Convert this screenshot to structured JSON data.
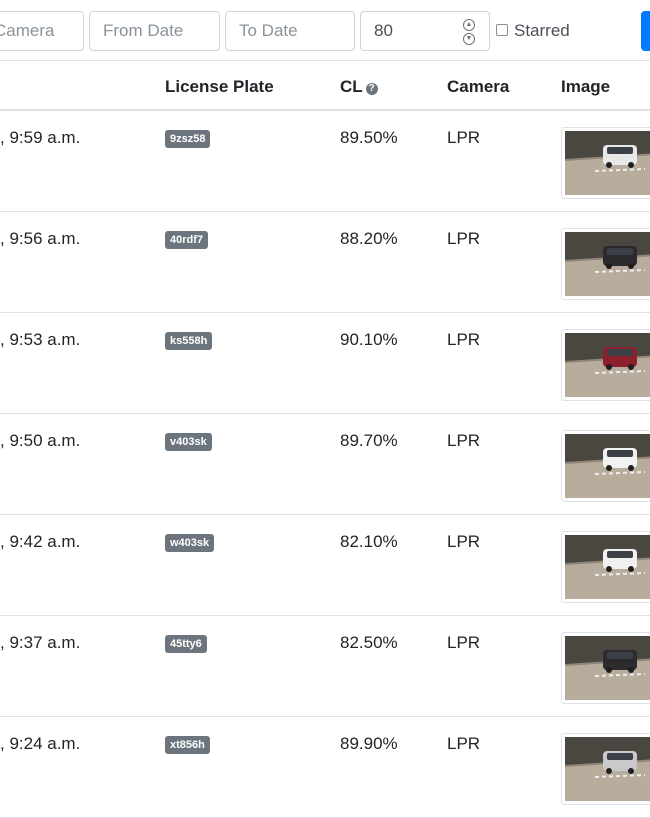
{
  "filters": {
    "camera_placeholder": "Camera",
    "from_date_placeholder": "From Date",
    "to_date_placeholder": "To Date",
    "confidence_value": "80",
    "starred_label": "Starred"
  },
  "table": {
    "headers": {
      "license_plate": "License Plate",
      "cl": "CL",
      "camera": "Camera",
      "image": "Image"
    },
    "rows": [
      {
        "time": ", 9:59 a.m.",
        "plate": "9zsz58",
        "cl": "89.50%",
        "camera": "LPR",
        "car_color": "#e8e8e8"
      },
      {
        "time": ", 9:56 a.m.",
        "plate": "40rdf7",
        "cl": "88.20%",
        "camera": "LPR",
        "car_color": "#2b2b2e"
      },
      {
        "time": ", 9:53 a.m.",
        "plate": "ks558h",
        "cl": "90.10%",
        "camera": "LPR",
        "car_color": "#8e1f2d"
      },
      {
        "time": ", 9:50 a.m.",
        "plate": "v403sk",
        "cl": "89.70%",
        "camera": "LPR",
        "car_color": "#f2f2f2"
      },
      {
        "time": ", 9:42 a.m.",
        "plate": "w403sk",
        "cl": "82.10%",
        "camera": "LPR",
        "car_color": "#f0f0f0"
      },
      {
        "time": ", 9:37 a.m.",
        "plate": "45tty6",
        "cl": "82.50%",
        "camera": "LPR",
        "car_color": "#2b2b2e"
      },
      {
        "time": ", 9:24 a.m.",
        "plate": "xt856h",
        "cl": "89.90%",
        "camera": "LPR",
        "car_color": "#c9c9cb"
      }
    ]
  }
}
